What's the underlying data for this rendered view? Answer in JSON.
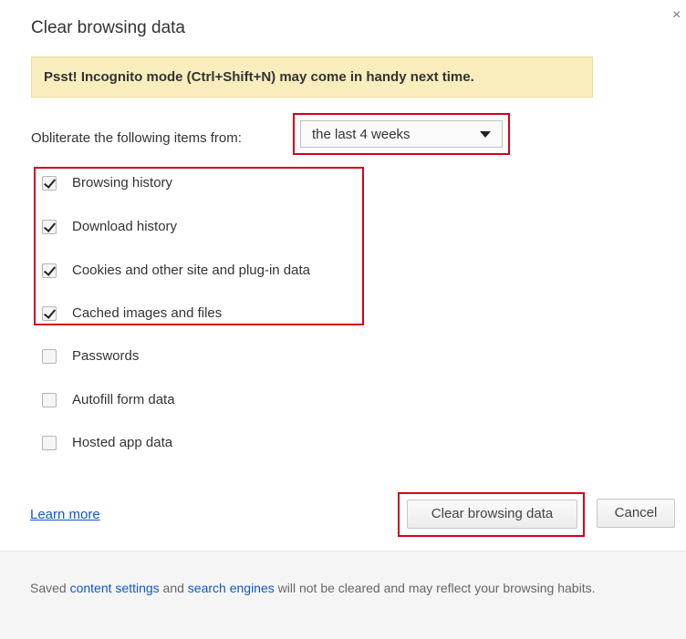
{
  "dialog": {
    "title": "Clear browsing data",
    "close_symbol": "×",
    "close_icon": "close-icon"
  },
  "banner": {
    "text": "Psst! Incognito mode (Ctrl+Shift+N) may come in handy next time.",
    "color": "#f9edbe"
  },
  "range": {
    "label": "Obliterate the following items from:",
    "selected": "the last 4 weeks",
    "caret_icon": "dropdown-arrow-icon"
  },
  "options": [
    {
      "label": "Browsing history",
      "checked": true
    },
    {
      "label": "Download history",
      "checked": true
    },
    {
      "label": "Cookies and other site and plug-in data",
      "checked": true
    },
    {
      "label": "Cached images and files",
      "checked": true
    },
    {
      "label": "Passwords",
      "checked": false
    },
    {
      "label": "Autofill form data",
      "checked": false
    },
    {
      "label": "Hosted app data",
      "checked": false
    }
  ],
  "actions": {
    "learn_more": "Learn more",
    "clear": "Clear browsing data",
    "cancel": "Cancel"
  },
  "footer": {
    "prefix": "Saved ",
    "link1": "content settings",
    "middle": " and ",
    "link2": "search engines",
    "suffix": " will not be cleared and may reflect your browsing habits."
  },
  "colors": {
    "highlight": "#d0021b",
    "link": "#1155cc",
    "footer_bg": "#f5f5f5"
  }
}
